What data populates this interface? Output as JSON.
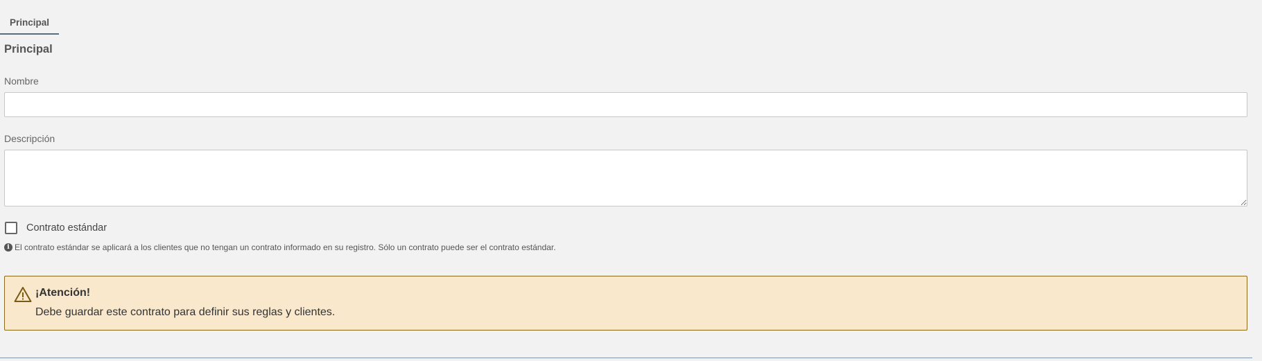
{
  "tabs": [
    {
      "label": "Principal",
      "active": true
    }
  ],
  "section": {
    "title": "Principal"
  },
  "form": {
    "nombre": {
      "label": "Nombre",
      "value": "",
      "placeholder": ""
    },
    "descripcion": {
      "label": "Descripción",
      "value": "",
      "placeholder": ""
    },
    "contrato_estandar": {
      "label": "Contrato estándar",
      "checked": false,
      "help": "El contrato estándar se aplicará a los clientes que no tengan un contrato informado en su registro. Sólo un contrato puede ser el contrato estándar.",
      "help_icon": "info-circle-icon"
    }
  },
  "alert": {
    "icon": "warning-triangle-icon",
    "title": "¡Atención!",
    "message": "Debe guardar este contrato para definir sus reglas y clientes.",
    "background": "#f9e8cb",
    "border": "#8a6a1a"
  },
  "colors": {
    "page_background": "#f2f2f2",
    "tab_underline": "#5a6b7a"
  }
}
